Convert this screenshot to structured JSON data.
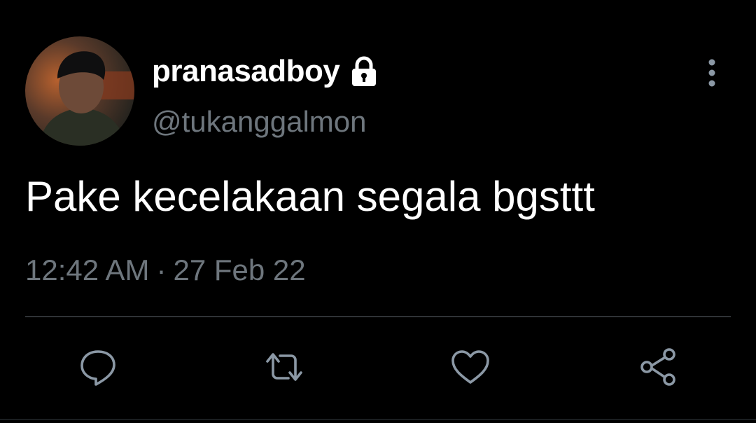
{
  "tweet": {
    "display_name": "pranasadboy",
    "protected_icon": "lock-icon",
    "handle": "@tukanggalmon",
    "text": "Pake kecelakaan segala bgsttt",
    "time": "12:42 AM",
    "separator": "·",
    "date": "27 Feb 22"
  },
  "actions": {
    "reply_icon": "speech-bubble-icon",
    "retweet_icon": "retweet-arrows-icon",
    "like_icon": "heart-icon",
    "share_icon": "share-nodes-icon",
    "more_icon": "vertical-ellipsis-icon"
  },
  "colors": {
    "background": "#000000",
    "text_primary": "#ffffff",
    "text_secondary": "#6e767d",
    "divider": "#2f3336",
    "icon": "#8b98a5"
  }
}
